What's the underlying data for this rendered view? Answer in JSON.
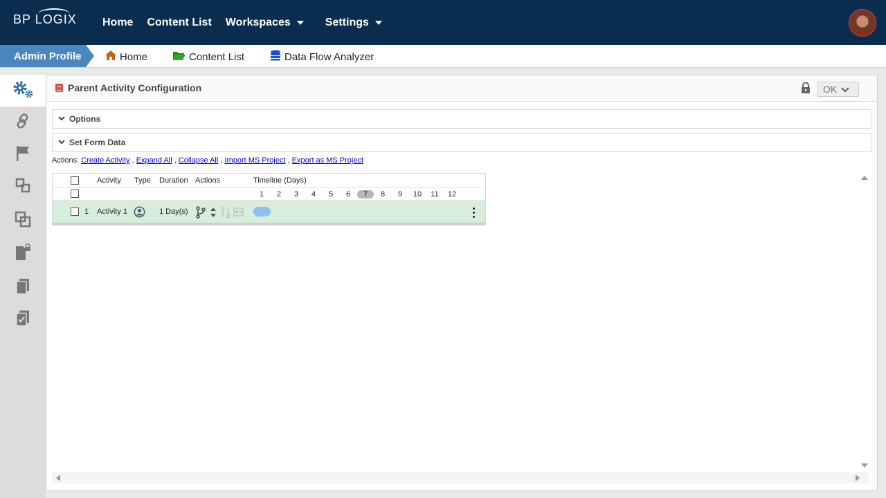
{
  "topbar": {
    "logo": "BP LOGIX",
    "nav": [
      {
        "label": "Home",
        "has_menu": false
      },
      {
        "label": "Content List",
        "has_menu": false
      },
      {
        "label": "Workspaces",
        "has_menu": true
      },
      {
        "label": "Settings",
        "has_menu": true
      }
    ],
    "avatar_icon": "user-avatar",
    "background_color": "#0a2d4f"
  },
  "breadcrumbs": {
    "profile": "Admin Profile",
    "items": [
      {
        "label": "Home",
        "icon": "home-icon"
      },
      {
        "label": "Content List",
        "icon": "folder-icon"
      },
      {
        "label": "Data Flow Analyzer",
        "icon": "database-icon"
      }
    ],
    "accent_color": "#4a86c0"
  },
  "sidebar": {
    "items": [
      {
        "icon": "settings-gears-icon",
        "active": true
      },
      {
        "icon": "link-icon",
        "active": false
      },
      {
        "icon": "flag-icon",
        "active": false
      },
      {
        "icon": "flow-icon",
        "active": false
      },
      {
        "icon": "copy-icon",
        "active": false
      },
      {
        "icon": "locked-document-icon",
        "active": false
      },
      {
        "icon": "documents-icon",
        "active": false
      },
      {
        "icon": "checklist-icon",
        "active": false
      }
    ]
  },
  "panel": {
    "title": "Parent Activity Configuration",
    "ok_label": "OK",
    "sections": [
      "Options",
      "Set Form Data"
    ],
    "actions_label": "Actions:",
    "actions": [
      "Create Activity",
      "Expand All",
      "Collapse All",
      "Import MS Project",
      "Export as MS Project"
    ]
  },
  "grid": {
    "columns": [
      "Activity",
      "Type",
      "Duration",
      "Actions",
      "Timeline (Days)"
    ],
    "days": [
      "1",
      "2",
      "3",
      "4",
      "5",
      "6",
      "7",
      "8",
      "9",
      "10",
      "11",
      "12"
    ],
    "highlight_day": "7",
    "rows": [
      {
        "num": "1",
        "activity": "Activity 1",
        "type_icon": "user-icon",
        "duration": "1 Day(s)",
        "row_color": "#d8eedd",
        "bar_color": "#8fc0f0"
      }
    ]
  }
}
